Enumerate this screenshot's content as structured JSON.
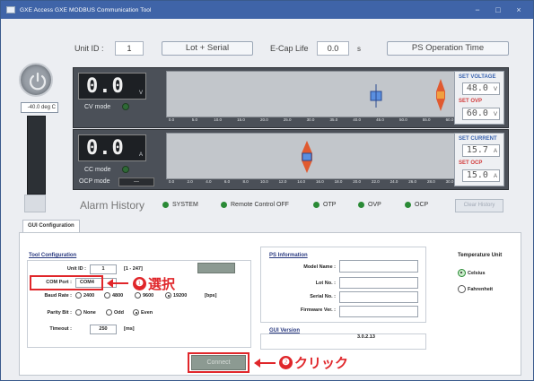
{
  "window": {
    "title": "GXE Access GXE MODBUS Communication Tool",
    "controls": {
      "minimize": "−",
      "maximize": "□",
      "close": "×"
    }
  },
  "topbar": {
    "unit_id_label": "Unit ID :",
    "unit_id_value": "1",
    "lot_serial_button": "Lot + Serial",
    "ecap_label": "E-Cap Life",
    "ecap_value": "0.0",
    "ecap_unit": "s",
    "ps_operation_button": "PS Operation Time"
  },
  "left": {
    "side_readout": "-40.0 deg C"
  },
  "voltage_panel": {
    "readout": "0.0",
    "unit": "V",
    "mode_label": "CV mode",
    "ticks": [
      "0.0",
      "5.0",
      "10.0",
      "15.0",
      "20.0",
      "25.0",
      "30.0",
      "35.0",
      "40.0",
      "45.0",
      "50.0",
      "55.0",
      "60.0"
    ],
    "set_title": "SET VOLTAGE",
    "set_value": "48.0",
    "set_unit": "V",
    "protect_title": "SET OVP",
    "protect_value": "60.0",
    "protect_unit": "V"
  },
  "current_panel": {
    "readout": "0.0",
    "unit": "A",
    "mode_label": "CC mode",
    "ocp_mode_label": "OCP mode",
    "ocp_mode_value": "—",
    "ticks": [
      "0.0",
      "2.0",
      "4.0",
      "6.0",
      "8.0",
      "10.0",
      "12.0",
      "14.0",
      "16.0",
      "18.0",
      "20.0",
      "22.0",
      "24.0",
      "26.0",
      "28.0",
      "30.0"
    ],
    "set_title": "SET CURRENT",
    "set_value": "15.7",
    "set_unit": "A",
    "protect_title": "SET OCP",
    "protect_value": "15.0",
    "protect_unit": "A"
  },
  "alarm": {
    "title": "Alarm History",
    "items": [
      "SYSTEM",
      "Remote Control OFF",
      "OTP",
      "OVP",
      "OCP"
    ],
    "clear_button": "Clear History",
    "led_color": "#2a8a36"
  },
  "tabs": [
    "GUI Configuration"
  ],
  "tool_config": {
    "title": "Tool Configuration",
    "unit_id_label": "Unit ID :",
    "unit_id_value": "1",
    "unit_id_range": "[1 - 247]",
    "com_port_label": "COM Port :",
    "com_port_value": "COM4",
    "baud_label": "Baud Rate :",
    "baud_options": [
      "2400",
      "4800",
      "9600",
      "19200"
    ],
    "baud_selected": "19200",
    "baud_unit": "[bps]",
    "parity_label": "Parity Bit :",
    "parity_options": [
      "None",
      "Odd",
      "Even"
    ],
    "parity_selected": "Even",
    "timeout_label": "Timeout :",
    "timeout_value": "250",
    "timeout_unit": "[ms]"
  },
  "ps_info": {
    "title": "PS Information",
    "model_label": "Model Name :",
    "lot_label": "Lot No. :",
    "serial_label": "Serial No. :",
    "firmware_label": "Firmware Ver. :",
    "gui_version_title": "GUI Version",
    "gui_version_value": "3.0.2.13"
  },
  "temperature": {
    "title": "Temperature Unit",
    "options": [
      "Celsius",
      "Fahrenheit"
    ],
    "selected": "Celsius"
  },
  "connect_button": "Connect",
  "annotations": {
    "step1_num": "❶",
    "step1_text": "選択",
    "step2_num": "❷",
    "step2_text": "クリック",
    "color": "#e0262a"
  }
}
